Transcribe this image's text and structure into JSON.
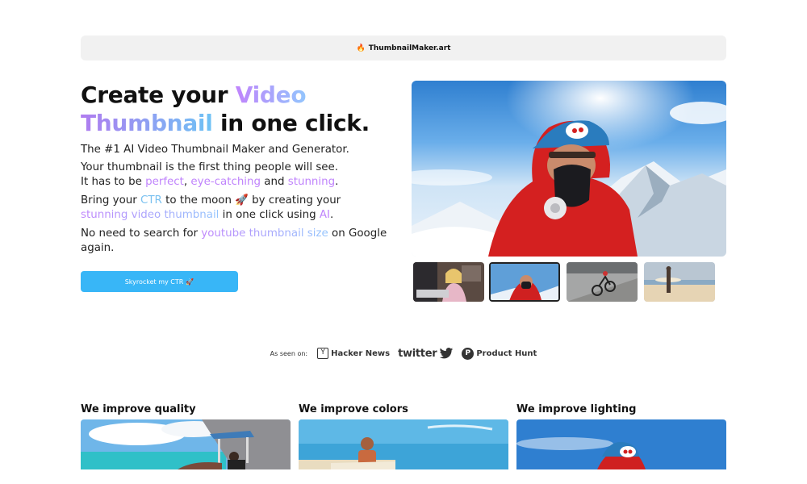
{
  "topbar": {
    "brand_icon": "fire-icon",
    "brand": "ThumbnailMaker.art"
  },
  "hero": {
    "title_part1": "Create your ",
    "title_highlight1": "Video",
    "title_highlight2": "Thumbnail",
    "title_part2": " in one click.",
    "subtitle": "The #1 AI Video Thumbnail Maker and Generator.",
    "line2a": "Your thumbnail is the first thing people will see.",
    "line2b_pre": "It has to be ",
    "line2b_hl1": "perfect",
    "line2b_sep1": ", ",
    "line2b_hl2": "eye-catching",
    "line2b_sep2": " and ",
    "line2b_hl3": "stunning",
    "line2b_end": ".",
    "line3_pre": "Bring your ",
    "line3_hl1": "CTR",
    "line3_mid": " to the moon 🚀 by creating your",
    "line3_hl2": "stunning video thumbnail",
    "line3_mid2": " in one click using ",
    "line3_hl3": "AI",
    "line3_end": ".",
    "line4_pre": "No need to search for ",
    "line4_hl": "youtube thumbnail size",
    "line4_post": " on Google",
    "line4_end": "again.",
    "cta_label": "Skyrocket my CTR",
    "cta_emoji": "🚀",
    "accent_color": "#38b6f7"
  },
  "gallery": {
    "main_image": "mountaineer-with-oxygen-mask",
    "thumbnails": [
      {
        "name": "woman-at-laptop",
        "selected": false
      },
      {
        "name": "mountaineer",
        "selected": true
      },
      {
        "name": "mountain-biker",
        "selected": false
      },
      {
        "name": "surfer-on-beach",
        "selected": false
      }
    ]
  },
  "seen_on": {
    "label": "As seen on:",
    "hn_icon": "Y",
    "hn": "Hacker News",
    "twitter": "twitter",
    "ph_icon": "P",
    "ph": "Product Hunt"
  },
  "features": [
    {
      "title": "We improve quality"
    },
    {
      "title": "We improve colors"
    },
    {
      "title": "We improve lighting"
    }
  ]
}
